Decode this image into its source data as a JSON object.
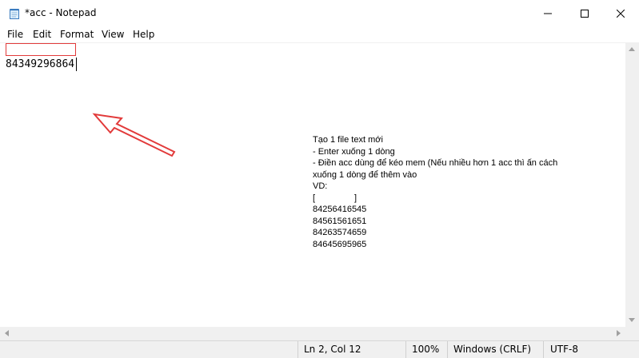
{
  "window": {
    "title": "*acc - Notepad",
    "icon": "notepad-icon"
  },
  "menu": {
    "items": [
      "File",
      "Edit",
      "Format",
      "View",
      "Help"
    ]
  },
  "editor": {
    "line2": "84349296864"
  },
  "note": {
    "lines": [
      "Tạo 1 file text mới",
      "- Enter xuống 1 dòng",
      "- Điền acc dùng để kéo mem (Nếu nhiều hơn 1 acc thì ấn cách",
      "xuống 1 dòng để thêm vào",
      "VD:",
      "[                ]",
      "84256416545",
      "84561561651",
      "84263574659",
      "84645695965"
    ]
  },
  "status": {
    "position": "Ln 2, Col 12",
    "zoom": "100%",
    "line_ending": "Windows (CRLF)",
    "encoding": "UTF-8"
  },
  "colors": {
    "annotation": "#e23a3a"
  }
}
